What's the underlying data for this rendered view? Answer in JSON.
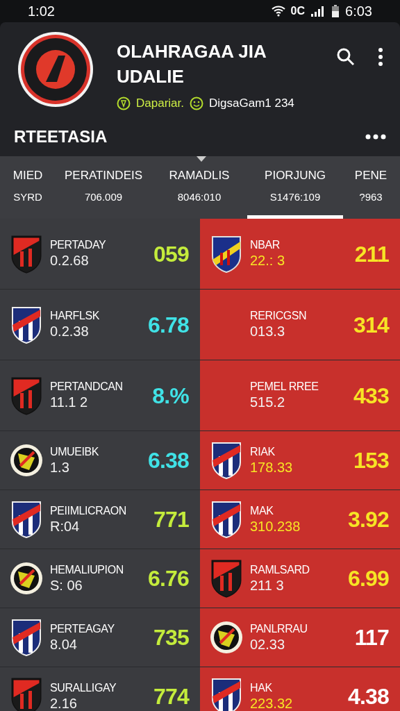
{
  "status_bar": {
    "time": "1:02",
    "network": "0C",
    "clock": "6:03"
  },
  "header": {
    "title": "OLAHRAGAA JIA UDALIE",
    "tag_1": "Dapariar.",
    "tag_2": "DigsaGam1 234",
    "section": "RTEETASIA"
  },
  "tabs": [
    {
      "label": "MIED",
      "value": "SYRD",
      "selected": false
    },
    {
      "label": "PERATINDEIS",
      "value": "706.009",
      "selected": false
    },
    {
      "label": "RAMADLIS",
      "value": "8046:010",
      "selected": false
    },
    {
      "label": "PIORJUNG",
      "value": "S1476:109",
      "selected": true
    },
    {
      "label": "PENE",
      "value": "?963",
      "selected": false
    }
  ],
  "rows": [
    {
      "left": {
        "name": "PERTADAY",
        "sub": "0.2.68",
        "score": "059",
        "color": "#c4ec3c",
        "kind": "red"
      },
      "right": {
        "name": "NBAR",
        "sub": "22.: 3",
        "score": "211",
        "color": "#f7e425",
        "highlight": true,
        "kind": "navy"
      }
    },
    {
      "left": {
        "name": "HARFLSK",
        "sub": "0.2.38",
        "score": "6.78",
        "color": "#40e2e6",
        "kind": "striped"
      },
      "right": {
        "name": "RERICGSN",
        "sub": "013.3",
        "score": "314",
        "color": "#f7e425",
        "highlight": false,
        "kind": "none"
      }
    },
    {
      "left": {
        "name": "PERTANDCAN",
        "sub": "11.1 2",
        "score": "8.%",
        "color": "#40e2e6",
        "kind": "red"
      },
      "right": {
        "name": "PEMEL RREE",
        "sub": "515.2",
        "score": "433",
        "color": "#f7e425",
        "highlight": false,
        "kind": "none"
      }
    },
    {
      "left": {
        "name": "UMUEIBK",
        "sub": "1.3",
        "score": "6.38",
        "color": "#40e2e6",
        "kind": "round"
      },
      "right": {
        "name": "RIAK",
        "sub": "178.33",
        "score": "153",
        "color": "#f7e425",
        "highlight": true,
        "kind": "striped"
      }
    },
    {
      "left": {
        "name": "PEIIMLICRAON",
        "sub": "R:04",
        "score": "771",
        "color": "#c4ec3c",
        "kind": "striped"
      },
      "right": {
        "name": "MAK",
        "sub": "310.238",
        "score": "3.92",
        "color": "#f7e425",
        "highlight": true,
        "kind": "striped"
      }
    },
    {
      "left": {
        "name": "HEMALIUPION",
        "sub": "S: 06",
        "score": "6.76",
        "color": "#c4ec3c",
        "kind": "round"
      },
      "right": {
        "name": "RAMLSARD",
        "sub": "211 3",
        "score": "6.99",
        "color": "#f7e425",
        "highlight": false,
        "kind": "red"
      }
    },
    {
      "left": {
        "name": "PERTEAGAY",
        "sub": "8.04",
        "score": "735",
        "color": "#c4ec3c",
        "kind": "striped"
      },
      "right": {
        "name": "PANLRRAU",
        "sub": "02.33",
        "score": "117",
        "color": "#ffffff",
        "highlight": false,
        "kind": "round"
      }
    },
    {
      "left": {
        "name": "SURALLIGAY",
        "sub": "2.16",
        "score": "774",
        "color": "#c4ec3c",
        "kind": "red"
      },
      "right": {
        "name": "HAK",
        "sub": "223.32",
        "score": "4.38",
        "color": "#ffffff",
        "highlight": true,
        "kind": "striped"
      }
    }
  ]
}
